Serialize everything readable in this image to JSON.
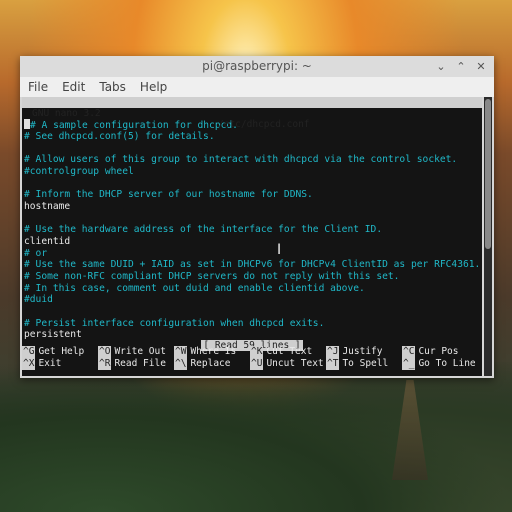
{
  "window": {
    "title": "pi@raspberrypi: ~",
    "controls": [
      "⌄",
      "⌃",
      "✕"
    ]
  },
  "menu": [
    "File",
    "Edit",
    "Tabs",
    "Help"
  ],
  "nano": {
    "version": "GNU nano 3.2",
    "filename": "/etc/dhcpcd.conf",
    "status": "[ Read 59 lines ]",
    "lines": [
      {
        "text": "# A sample configuration for dhcpcd.",
        "kind": "comment"
      },
      {
        "text": "# See dhcpcd.conf(5) for details.",
        "kind": "comment"
      },
      {
        "text": "",
        "kind": "plain"
      },
      {
        "text": "# Allow users of this group to interact with dhcpcd via the control socket.",
        "kind": "comment"
      },
      {
        "text": "#controlgroup wheel",
        "kind": "comment"
      },
      {
        "text": "",
        "kind": "plain"
      },
      {
        "text": "# Inform the DHCP server of our hostname for DDNS.",
        "kind": "comment"
      },
      {
        "text": "hostname",
        "kind": "plain"
      },
      {
        "text": "",
        "kind": "plain"
      },
      {
        "text": "# Use the hardware address of the interface for the Client ID.",
        "kind": "comment"
      },
      {
        "text": "clientid",
        "kind": "plain"
      },
      {
        "text": "# or",
        "kind": "comment"
      },
      {
        "text": "# Use the same DUID + IAID as set in DHCPv6 for DHCPv4 ClientID as per RFC4361.",
        "kind": "comment"
      },
      {
        "text": "# Some non-RFC compliant DHCP servers do not reply with this set.",
        "kind": "comment"
      },
      {
        "text": "# In this case, comment out duid and enable clientid above.",
        "kind": "comment"
      },
      {
        "text": "#duid",
        "kind": "comment"
      },
      {
        "text": "",
        "kind": "plain"
      },
      {
        "text": "# Persist interface configuration when dhcpcd exits.",
        "kind": "comment"
      },
      {
        "text": "persistent",
        "kind": "plain"
      }
    ],
    "shortcuts": [
      [
        {
          "key": "^G",
          "label": "Get Help"
        },
        {
          "key": "^O",
          "label": "Write Out"
        },
        {
          "key": "^W",
          "label": "Where Is"
        },
        {
          "key": "^K",
          "label": "Cut Text"
        },
        {
          "key": "^J",
          "label": "Justify"
        },
        {
          "key": "^C",
          "label": "Cur Pos"
        }
      ],
      [
        {
          "key": "^X",
          "label": "Exit"
        },
        {
          "key": "^R",
          "label": "Read File"
        },
        {
          "key": "^\\",
          "label": "Replace"
        },
        {
          "key": "^U",
          "label": "Uncut Text"
        },
        {
          "key": "^T",
          "label": "To Spell"
        },
        {
          "key": "^_",
          "label": "Go To Line"
        }
      ]
    ]
  }
}
